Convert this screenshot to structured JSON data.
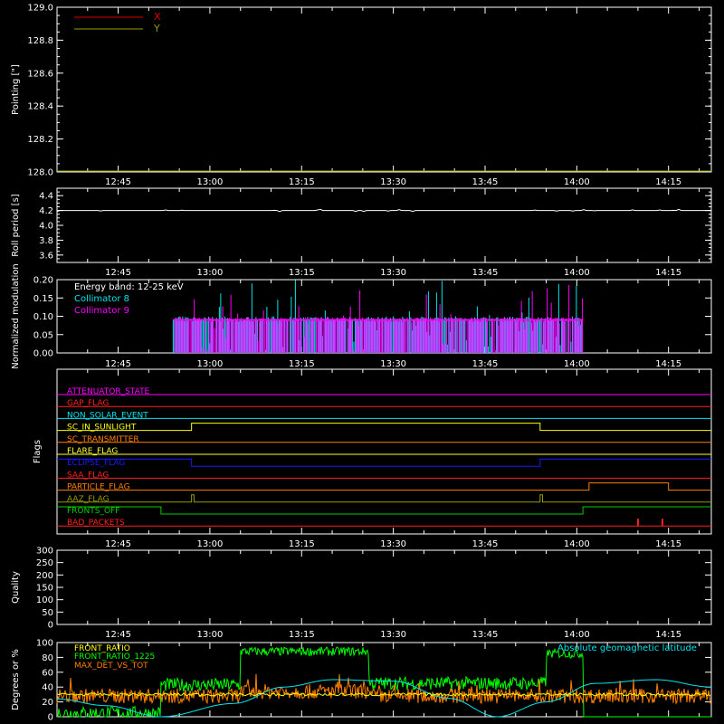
{
  "colors": {
    "background": "#000000",
    "axes": "#ffffff",
    "x_series": "#e00000",
    "y_series": "#9a9a00",
    "collimator8": "#00e5ee",
    "collimator9": "#ff00ff",
    "attenuator": "#ff00ff",
    "gap": "#ff2020",
    "non_solar": "#00e5ee",
    "sunlight": "#ffff00",
    "transmitter": "#ff8000",
    "flare": "#ffff30",
    "eclipse": "#1a1aff",
    "saa": "#ff2020",
    "particle": "#ff8000",
    "aaz": "#9a9a00",
    "fronts_off": "#00d000",
    "bad_packets": "#ff2020",
    "front_ratio": "#ffff00",
    "front_ratio_1225": "#00ff00",
    "max_det": "#ff8000",
    "geomag": "#00e5ee"
  },
  "time_axis": {
    "start": "12:35",
    "end": "14:22",
    "tick_labels": [
      "12:45",
      "13:00",
      "13:15",
      "13:30",
      "13:45",
      "14:00",
      "14:15"
    ],
    "tick_minutes": [
      765,
      780,
      795,
      810,
      825,
      840,
      855
    ],
    "minor_step_minutes": 5
  },
  "chart_data": [
    {
      "type": "line",
      "panel": "pointing",
      "ylabel": "Pointing [\"]",
      "ylim": [
        128.0,
        129.0
      ],
      "ytick_labels": [
        "128.0",
        "128.2",
        "128.4",
        "128.6",
        "128.8",
        "129.0"
      ],
      "series": [
        {
          "name": "X",
          "color_key": "x_series",
          "x": [
            "12:35",
            "14:22"
          ],
          "values": [
            128.0,
            128.0
          ]
        },
        {
          "name": "Y",
          "color_key": "y_series",
          "x": [
            "12:35",
            "14:22"
          ],
          "values": [
            128.0,
            128.0
          ]
        }
      ]
    },
    {
      "type": "line",
      "panel": "roll",
      "ylabel": "Roll period [s]",
      "ylim": [
        3.5,
        4.5
      ],
      "ytick_labels": [
        "3.6",
        "3.8",
        "4.0",
        "4.2",
        "4.4"
      ],
      "series": [
        {
          "color_key": "axes",
          "x": [
            "12:35",
            "14:22"
          ],
          "values": [
            4.2,
            4.2
          ]
        }
      ]
    },
    {
      "type": "bar",
      "panel": "modulation",
      "ylabel": "Normalized modulation",
      "ylim": [
        0.0,
        0.2
      ],
      "ytick_labels": [
        "0.00",
        "0.05",
        "0.10",
        "0.15",
        "0.20"
      ],
      "annotation": "Energy band: 12-25 keV",
      "active_window": [
        "12:54",
        "14:01"
      ],
      "baseline_value": 0.09,
      "series": [
        {
          "name": "Collimator 8",
          "color_key": "collimator8",
          "spike_max": 0.2
        },
        {
          "name": "Collimator 9",
          "color_key": "collimator9",
          "spike_max": 0.19
        }
      ]
    },
    {
      "type": "line",
      "panel": "flags",
      "ylabel": "Flags",
      "flags": [
        {
          "name": "ATTENUATOR_STATE",
          "color_key": "attenuator",
          "steps": [
            [
              "12:35",
              0
            ]
          ]
        },
        {
          "name": "GAP_FLAG",
          "color_key": "gap",
          "steps": [
            [
              "12:35",
              0
            ]
          ]
        },
        {
          "name": "NON_SOLAR_EVENT",
          "color_key": "non_solar",
          "steps": [
            [
              "12:35",
              0
            ]
          ]
        },
        {
          "name": "SC_IN_SUNLIGHT",
          "color_key": "sunlight",
          "steps": [
            [
              "12:35",
              0
            ],
            [
              "12:57",
              1
            ],
            [
              "13:54",
              0
            ]
          ]
        },
        {
          "name": "SC_TRANSMITTER",
          "color_key": "transmitter",
          "steps": [
            [
              "12:35",
              0
            ]
          ]
        },
        {
          "name": "FLARE_FLAG",
          "color_key": "flare",
          "steps": [
            [
              "12:35",
              0
            ]
          ]
        },
        {
          "name": "ECLIPSE_FLAG",
          "color_key": "eclipse",
          "steps": [
            [
              "12:35",
              1
            ],
            [
              "12:57",
              0
            ],
            [
              "13:54",
              1
            ]
          ]
        },
        {
          "name": "SAA_FLAG",
          "color_key": "saa",
          "steps": [
            [
              "12:35",
              0
            ]
          ]
        },
        {
          "name": "PARTICLE_FLAG",
          "color_key": "particle",
          "steps": [
            [
              "12:35",
              0
            ],
            [
              "14:02",
              1
            ],
            [
              "14:15",
              0
            ]
          ]
        },
        {
          "name": "AAZ_FLAG",
          "color_key": "aaz",
          "steps": [
            [
              "12:35",
              0
            ],
            [
              "12:57",
              1
            ],
            [
              "12:57.4",
              0
            ],
            [
              "13:54",
              1
            ],
            [
              "13:54.4",
              0
            ]
          ]
        },
        {
          "name": "FRONTS_OFF",
          "color_key": "fronts_off",
          "steps": [
            [
              "12:35",
              1
            ],
            [
              "12:52",
              0
            ],
            [
              "14:01",
              1
            ]
          ]
        },
        {
          "name": "BAD_PACKETS",
          "color_key": "bad_packets",
          "spikes": [
            "14:10",
            "14:14"
          ]
        }
      ]
    },
    {
      "type": "line",
      "panel": "quality",
      "ylabel": "Quality",
      "ylim": [
        0,
        300
      ],
      "ytick_labels": [
        "0",
        "50",
        "100",
        "150",
        "200",
        "250",
        "300"
      ],
      "series": [
        {
          "color_key": "axes",
          "x": [
            "12:35",
            "14:22"
          ],
          "values": [
            0,
            0
          ]
        }
      ]
    },
    {
      "type": "line",
      "panel": "ratios",
      "ylabel": "Degrees or %",
      "ylim": [
        0,
        100
      ],
      "ytick_labels": [
        "0",
        "20",
        "40",
        "60",
        "80",
        "100"
      ],
      "annotation": "Absolute geomagnetic latitude",
      "series": [
        {
          "name": "FRONT_RATIO",
          "color_key": "front_ratio"
        },
        {
          "name": "FRONT_RATIO_1225",
          "color_key": "front_ratio_1225",
          "levels": [
            [
              "12:35",
              5
            ],
            [
              "12:52",
              43
            ],
            [
              "13:05",
              88
            ],
            [
              "13:26",
              45
            ],
            [
              "13:55",
              85
            ],
            [
              "14:01",
              0
            ]
          ]
        },
        {
          "name": "MAX_DET_VS_TOT",
          "color_key": "max_det",
          "mean": 28
        },
        {
          "name": "",
          "color_key": "geomag",
          "x": [
            "12:35",
            "12:43",
            "12:52",
            "13:04",
            "13:12",
            "13:20",
            "13:30",
            "13:39",
            "13:47",
            "13:55",
            "14:03",
            "14:13",
            "14:22"
          ],
          "values": [
            24,
            15,
            0,
            18,
            40,
            50,
            48,
            25,
            0,
            20,
            45,
            50,
            40
          ]
        }
      ]
    }
  ]
}
